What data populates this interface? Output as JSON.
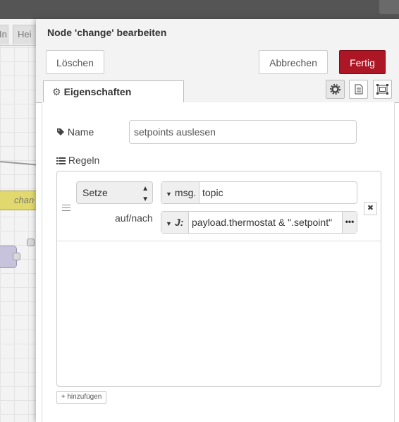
{
  "workspace": {
    "tabs": [
      "In",
      "Hei"
    ],
    "node_label": "chan"
  },
  "editor": {
    "title": "Node 'change' bearbeiten",
    "buttons": {
      "delete": "Löschen",
      "cancel": "Abbrechen",
      "done": "Fertig"
    },
    "tabs": {
      "properties": "Eigenschaften"
    },
    "icons": [
      "gear-icon",
      "document-icon",
      "frame-icon"
    ],
    "name_label": "Name",
    "name_value": "setpoints auslesen",
    "rules_label": "Regeln",
    "rule": {
      "action": "Setze",
      "target_type": "msg.",
      "target_value": "topic",
      "to_label": "auf/nach",
      "value_type": "J:",
      "value": "payload.thermostat & \".setpoint\""
    },
    "add_button": "hinzufügen"
  },
  "colors": {
    "primary_button": "#ad1625",
    "change_node": "#e2d96e",
    "header_bg": "#555555"
  }
}
